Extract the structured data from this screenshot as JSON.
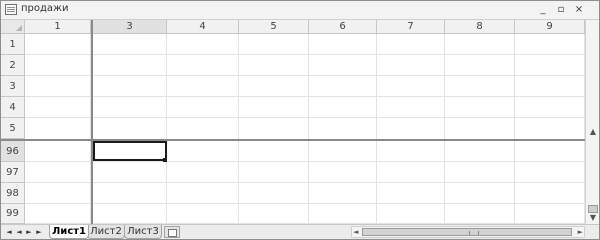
{
  "window": {
    "title": "продажи",
    "minimize_label": "_",
    "restore_label": "▫",
    "close_label": "×"
  },
  "sheet": {
    "column_headers": [
      "1",
      "3",
      "4",
      "5",
      "6",
      "7",
      "8",
      "9"
    ],
    "row_headers": [
      "1",
      "2",
      "3",
      "4",
      "5",
      "96",
      "97",
      "98",
      "99"
    ]
  },
  "tabs": [
    {
      "label": "Лист1",
      "active": true
    },
    {
      "label": "Лист2",
      "active": false
    },
    {
      "label": "Лист3",
      "active": false
    }
  ],
  "nav": {
    "first": "◄",
    "prev": "◄",
    "next": "►",
    "last": "►"
  },
  "scroll": {
    "up": "▲",
    "down": "▼",
    "left": "◄",
    "right": "►"
  }
}
